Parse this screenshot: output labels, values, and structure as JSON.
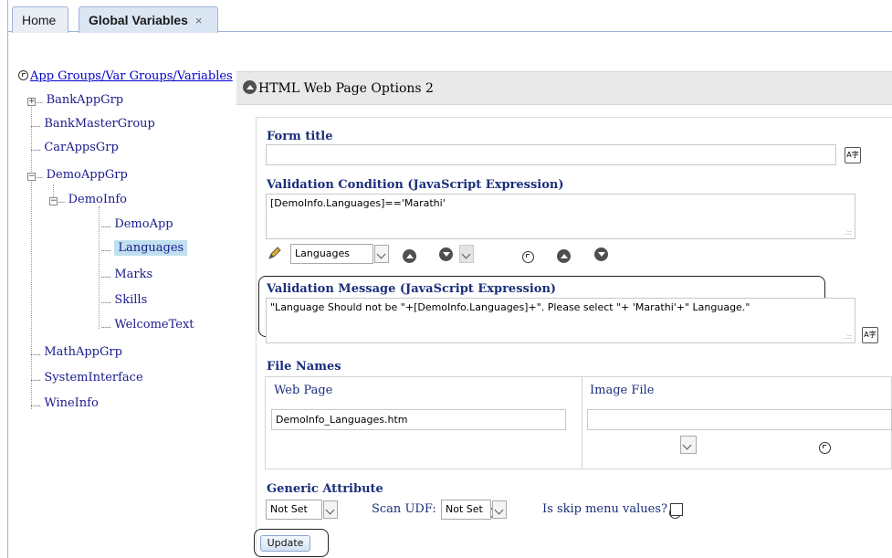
{
  "tabs": [
    {
      "label": "Home"
    },
    {
      "label": "Global Variables",
      "close": "×"
    }
  ],
  "tree": {
    "root": "App Groups/Var Groups/Variables",
    "nodes": [
      {
        "label": "BankAppGrp"
      },
      {
        "label": "BankMasterGroup"
      },
      {
        "label": "CarAppsGrp"
      },
      {
        "label": "DemoAppGrp"
      },
      {
        "label": "DemoInfo"
      },
      {
        "label": "DemoApp"
      },
      {
        "label": "Languages"
      },
      {
        "label": "Marks"
      },
      {
        "label": "Skills"
      },
      {
        "label": "WelcomeText"
      },
      {
        "label": "MathAppGrp"
      },
      {
        "label": "SystemInterface"
      },
      {
        "label": "WineInfo"
      }
    ]
  },
  "panel": {
    "title": "HTML Web Page Options 2",
    "form_title_label": "Form title",
    "form_title_value": "",
    "validation_condition_label": "Validation Condition (JavaScript Expression)",
    "validation_condition_value": "[DemoInfo.Languages]=='Marathi'",
    "variable_select_value": "Languages",
    "validation_message_label": "Validation Message (JavaScript Expression)",
    "validation_message_value": "\"Language Should not be \"+[DemoInfo.Languages]+\". Please select \"+ 'Marathi'+\" Language.\"",
    "file_names_label": "File Names",
    "web_page_label": "Web Page",
    "web_page_value": "DemoInfo_Languages.htm",
    "image_file_label": "Image File",
    "image_file_value": "",
    "generic_attribute_label": "Generic Attribute",
    "generic_attribute_value": "Not Set",
    "scan_udf_label": "Scan UDF:",
    "scan_udf_value": "Not Set",
    "skip_menu_label": "Is skip menu values?",
    "update_label": "Update"
  },
  "icons": {
    "spell": "A",
    "spell_sub": "字"
  },
  "colors": {
    "selected_bg": "#bfe0ee",
    "label_blue": "#1a2f7a",
    "tab_border": "#9db4d6"
  }
}
